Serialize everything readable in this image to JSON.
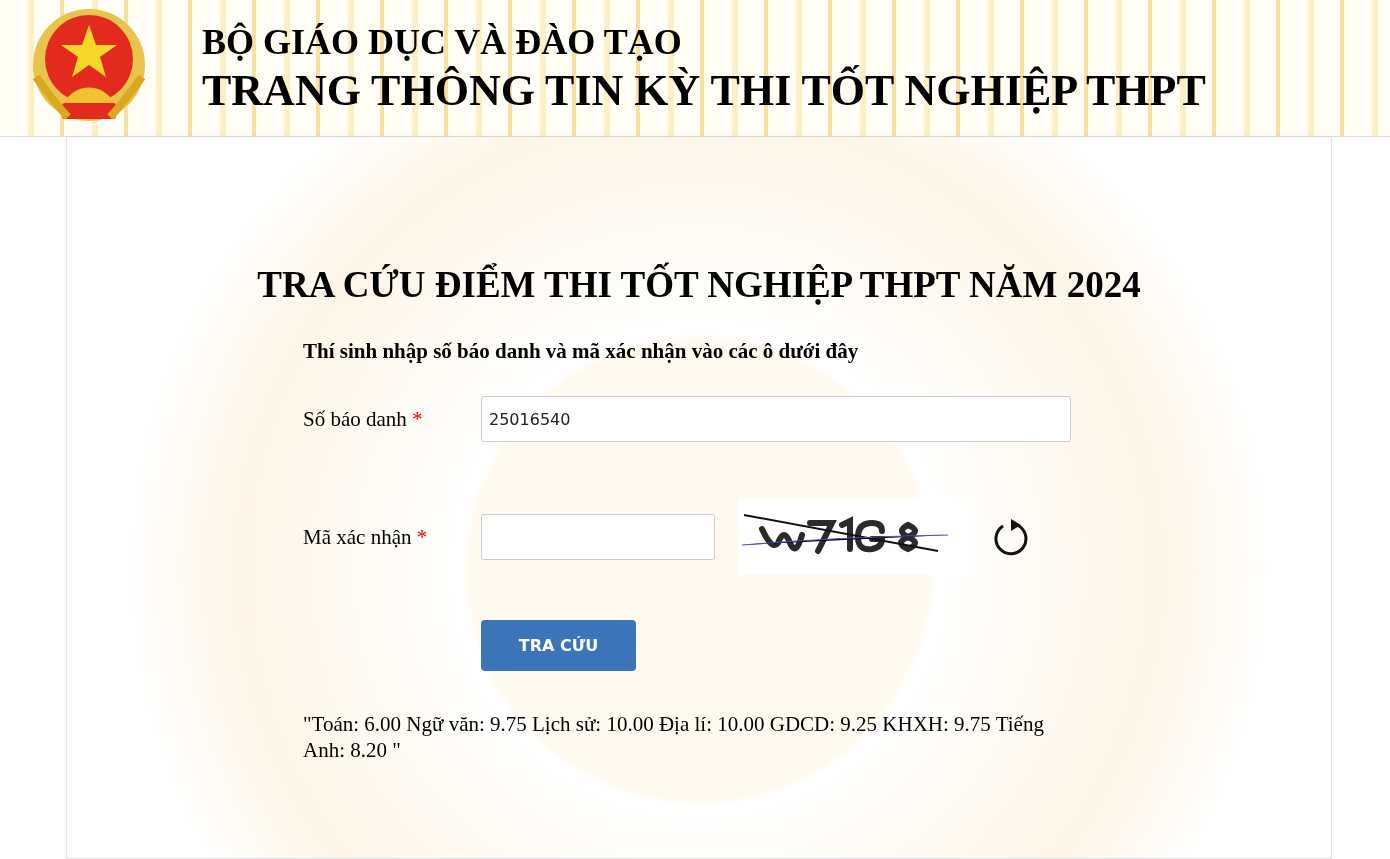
{
  "header": {
    "ministry": "BỘ GIÁO DỤC VÀ ĐÀO TẠO",
    "site_title": "TRANG THÔNG TIN KỲ THI TỐT NGHIỆP THPT"
  },
  "form": {
    "title": "TRA CỨU ĐIỂM THI TỐT NGHIỆP THPT NĂM 2024",
    "instruction": "Thí sinh nhập số báo danh và mã xác nhận vào các ô dưới đây",
    "fields": [
      {
        "kind": "text",
        "label": "Số báo danh",
        "required_mark": "*",
        "value": "25016540"
      },
      {
        "kind": "captcha",
        "label": "Mã xác nhận",
        "required_mark": "*"
      }
    ],
    "submit": "TRA CỨU",
    "result": "\"Toán: 6.00 Ngữ văn: 9.75 Lịch sử: 10.00 Địa lí: 10.00 GDCD: 9.25 KHXH: 9.75 Tiếng Anh: 8.20 \""
  }
}
